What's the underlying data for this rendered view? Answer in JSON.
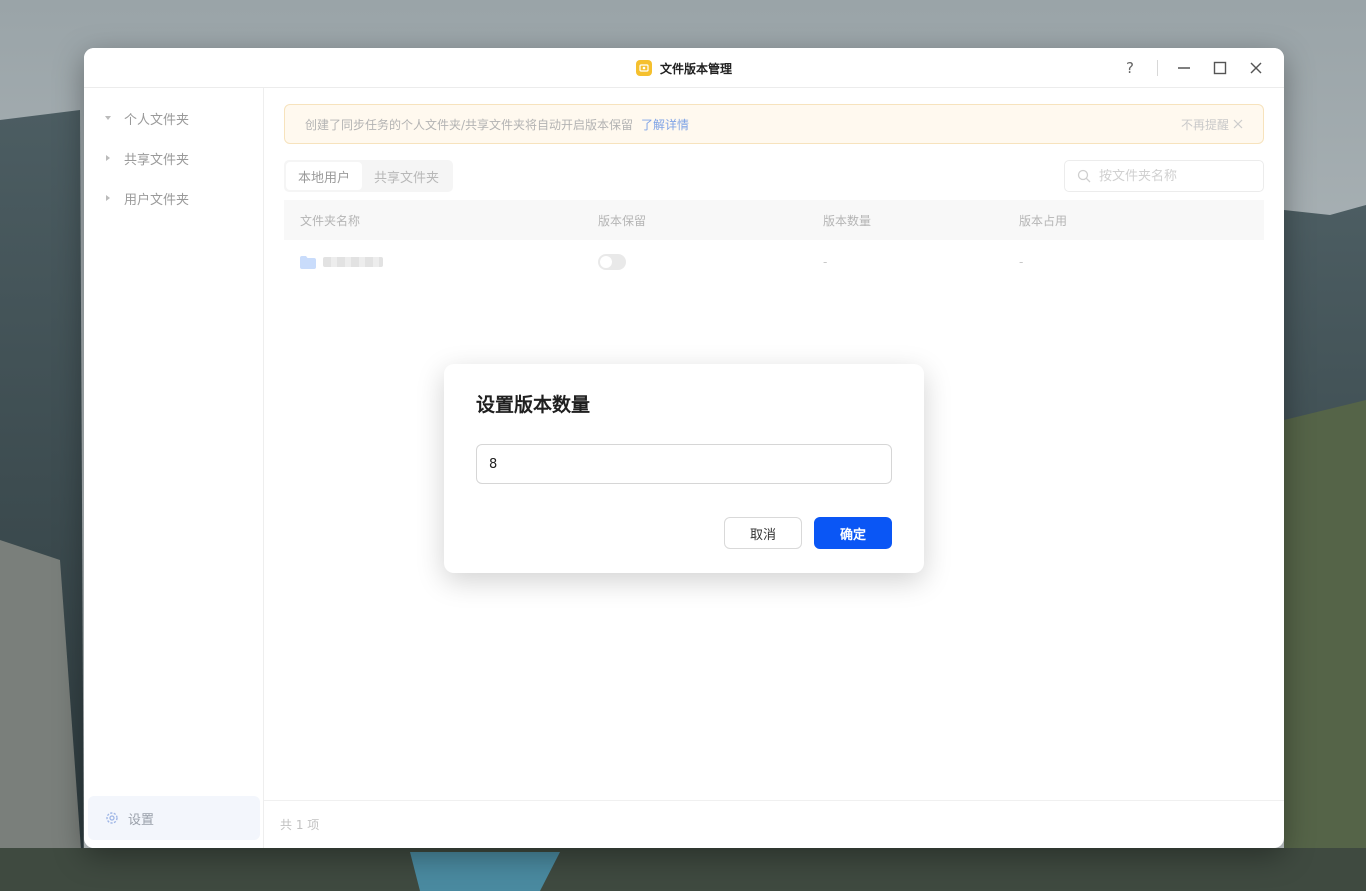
{
  "window": {
    "title": "文件版本管理"
  },
  "sidebar": {
    "items": [
      {
        "label": "个人文件夹"
      },
      {
        "label": "共享文件夹"
      },
      {
        "label": "用户文件夹"
      }
    ],
    "settings_label": "设置"
  },
  "banner": {
    "text": "创建了同步任务的个人文件夹/共享文件夹将自动开启版本保留",
    "link": "了解详情",
    "dismiss": "不再提醒"
  },
  "tabs": [
    {
      "label": "本地用户",
      "active": true
    },
    {
      "label": "共享文件夹",
      "active": false
    }
  ],
  "search": {
    "placeholder": "按文件夹名称"
  },
  "table": {
    "columns": [
      "文件夹名称",
      "版本保留",
      "版本数量",
      "版本占用"
    ],
    "rows": [
      {
        "name_redacted": true,
        "retention_on": false,
        "count": "-",
        "usage": "-"
      }
    ]
  },
  "footer": {
    "total": "共 1 项"
  },
  "dialog": {
    "title": "设置版本数量",
    "input_value": "8",
    "cancel_label": "取消",
    "ok_label": "确定"
  },
  "colors": {
    "accent": "#0a56f5",
    "app_icon": "#f5c02e",
    "banner_bg": "#fff9ef",
    "link": "#7fa3e6"
  }
}
